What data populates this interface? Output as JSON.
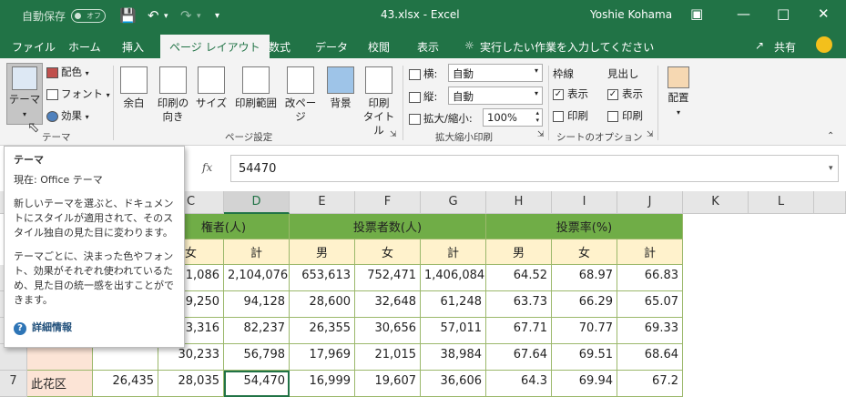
{
  "titlebar": {
    "autosave": "自動保存",
    "toggle": "オフ",
    "filename": "43.xlsx - Excel",
    "user": "Yoshie Kohama"
  },
  "tabs": [
    "ファイル",
    "ホーム",
    "挿入",
    "ページ レイアウト",
    "数式",
    "データ",
    "校閲",
    "表示",
    "実行したい作業を入力してください",
    "共有"
  ],
  "ribbon": {
    "theme": "テーマ",
    "colors": "配色",
    "fonts": "フォント",
    "effects": "効果",
    "group_theme": "テーマ",
    "margins": "余白",
    "orientation": "印刷の\n向き",
    "size": "サイズ",
    "print_area": "印刷範囲",
    "breaks": "改ページ",
    "background": "背景",
    "print_titles": "印刷\nタイトル",
    "group_page_setup": "ページ設定",
    "width_label": "横:",
    "width_value": "自動",
    "height_label": "縦:",
    "height_value": "自動",
    "scale_label": "拡大/縮小:",
    "scale_value": "100%",
    "group_scale": "拡大縮小印刷",
    "gridlines": "枠線",
    "headings": "見出し",
    "view": "表示",
    "print": "印刷",
    "group_sheet_options": "シートのオプション",
    "arrange": "配置"
  },
  "formula": {
    "fx": "fx",
    "value": "54470"
  },
  "tooltip": {
    "title": "テーマ",
    "current": "現在: Office テーマ",
    "desc1": "新しいテーマを選ぶと、ドキュメントにスタイルが適用されて、そのスタイル独自の見た目に変わります。",
    "desc2": "テーマごとに、決まった色やフォント、効果がそれぞれ使われているため、見た目の統一感を出すことができます。",
    "more": "詳細情報"
  },
  "columns": [
    "C",
    "D",
    "E",
    "F",
    "G",
    "H",
    "I",
    "J",
    "K",
    "L"
  ],
  "header1": [
    "権者(人)",
    "投票者数(人)",
    "投票率(%)"
  ],
  "header2": [
    "女",
    "計",
    "男",
    "女",
    "計",
    "男",
    "女",
    "計"
  ],
  "rows": [
    {
      "num": "",
      "a": "",
      "b": "",
      "c": "91,086",
      "d": "2,104,076",
      "e": "653,613",
      "f": "752,471",
      "g": "1,406,084",
      "h": "64.52",
      "i": "68.97",
      "j": "66.83"
    },
    {
      "num": "",
      "a": "",
      "b": "",
      "c": "49,250",
      "d": "94,128",
      "e": "28,600",
      "f": "32,648",
      "g": "61,248",
      "h": "63.73",
      "i": "66.29",
      "j": "65.07"
    },
    {
      "num": "",
      "a": "",
      "b": "",
      "c": "43,316",
      "d": "82,237",
      "e": "26,355",
      "f": "30,656",
      "g": "57,011",
      "h": "67.71",
      "i": "70.77",
      "j": "69.33"
    },
    {
      "num": "",
      "a": "",
      "b": "",
      "c": "30,233",
      "d": "56,798",
      "e": "17,969",
      "f": "21,015",
      "g": "38,984",
      "h": "67.64",
      "i": "69.51",
      "j": "68.64"
    },
    {
      "num": "7",
      "a": "此花区",
      "b": "26,435",
      "c": "28,035",
      "d": "54,470",
      "e": "16,999",
      "f": "19,607",
      "g": "36,606",
      "h": "64.3",
      "i": "69.94",
      "j": "67.2"
    }
  ]
}
